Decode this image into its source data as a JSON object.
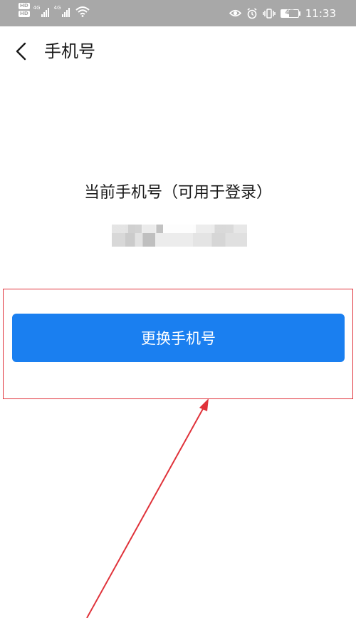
{
  "status_bar": {
    "hd_badge_1": "HD",
    "hd_badge_2": "HD",
    "signal_1_label": "4G",
    "signal_2_label": "4G",
    "battery_level": "47",
    "time": "11:33"
  },
  "header": {
    "title": "手机号"
  },
  "main": {
    "current_label": "当前手机号（可用于登录）",
    "change_button_label": "更换手机号"
  },
  "colors": {
    "primary_button": "#1a7ff0",
    "annotation_red": "#e0323a",
    "status_bar_bg": "#a8a8a8"
  },
  "icons": {
    "back": "chevron-left-icon",
    "wifi": "wifi-icon",
    "eye": "eye-icon",
    "alarm": "alarm-icon",
    "vibrate": "vibrate-icon",
    "battery": "battery-icon"
  }
}
